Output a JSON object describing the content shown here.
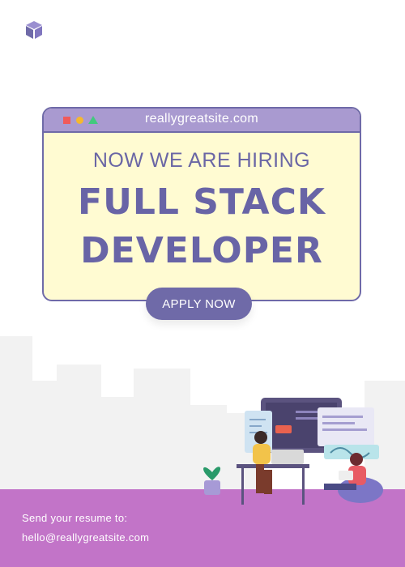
{
  "brand": {
    "logo_icon": "cube-logo-icon"
  },
  "browser": {
    "url": "reallygreatsite.com"
  },
  "headline": {
    "subtitle": "NOW WE ARE HIRING",
    "title_line1": "FULL STACK",
    "title_line2": "DEVELOPER"
  },
  "cta": {
    "label": "APPLY NOW"
  },
  "contact": {
    "prompt": "Send your resume to:",
    "email": "hello@reallygreatsite.com"
  },
  "colors": {
    "primary": "#6f6aa8",
    "card_bg": "#fffbd2",
    "footer": "#c274c8",
    "browser_bar": "#a99ad0"
  }
}
